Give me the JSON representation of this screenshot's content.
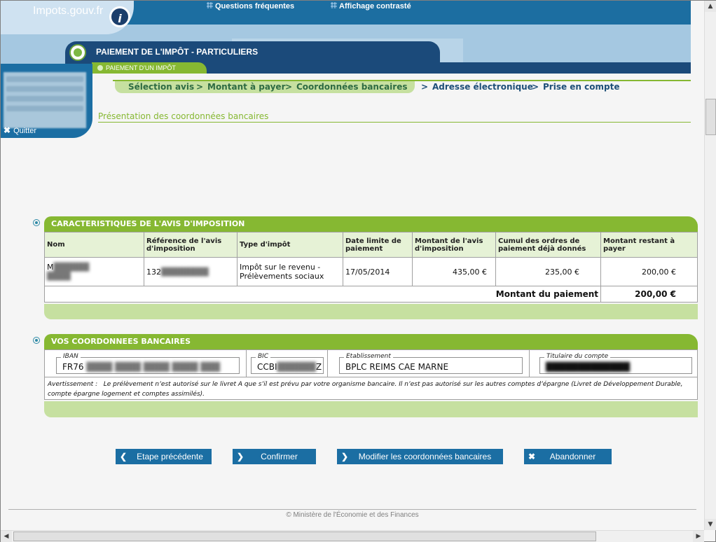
{
  "header": {
    "logo": "Impots.gouv.fr",
    "links": [
      "Questions fréquentes",
      "Affichage contrasté"
    ],
    "title": "PAIEMENT DE L'IMPÔT - PARTICULIERS",
    "subtab": "PAIEMENT D'UN IMPÔT"
  },
  "user_panel": {
    "quit_label": "Quitter"
  },
  "breadcrumb": {
    "done": [
      "Sélection avis",
      "Montant à payer",
      "Coordonnées bancaires"
    ],
    "todo": [
      "Adresse électronique",
      "Prise en compte"
    ],
    "separator": ">"
  },
  "page_title": "Présentation des coordonnées bancaires",
  "avis": {
    "title": "CARACTERISTIQUES DE L'AVIS D'IMPOSITION",
    "headers": [
      "Nom",
      "Référence de l'avis d'imposition",
      "Type d'impôt",
      "Date limite de paiement",
      "Montant de l'avis d'imposition",
      "Cumul des ordres de paiement déjà donnés",
      "Montant restant à payer"
    ],
    "row": {
      "nom": "M",
      "reference": "132",
      "type": "Impôt sur le revenu - Prélèvements sociaux",
      "date": "17/05/2014",
      "montant": "435,00 €",
      "cumul": "235,00 €",
      "restant": "200,00 €"
    },
    "total_label": "Montant du paiement",
    "total_value": "200,00 €"
  },
  "bank": {
    "title": "VOS COORDONNEES BANCAIRES",
    "iban_label": "IBAN",
    "iban_value": "FR76",
    "bic_label": "BIC",
    "bic_value": "CCBI",
    "bic_suffix": "Z",
    "etab_label": "Etablissement",
    "etab_value": "BPLC REIMS CAE MARNE",
    "titulaire_label": "Titulaire du compte",
    "warning_label": "Avertissement :",
    "warning_text": "Le prélèvement n’est autorisé sur le livret A que s’il est prévu par votre organisme bancaire. Il n’est pas autorisé sur les autres comptes d’épargne (Livret de Développement Durable, compte épargne logement et comptes assimilés)."
  },
  "buttons": {
    "prev": "Etape précédente",
    "confirm": "Confirmer",
    "modify": "Modifier les coordonnées bancaires",
    "cancel": "Abandonner"
  },
  "footer": "© Ministère de l'Économie et des Finances"
}
